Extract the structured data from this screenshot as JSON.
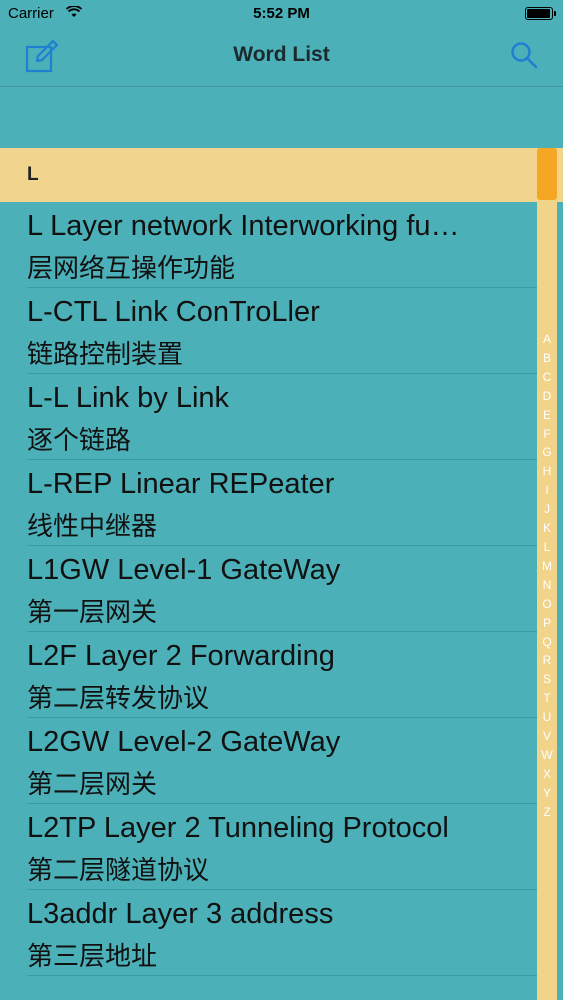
{
  "status": {
    "carrier": "Carrier",
    "time": "5:52 PM"
  },
  "nav": {
    "title": "Word List"
  },
  "section": {
    "letter": "L"
  },
  "words": [
    {
      "en": "L Layer network Interworking fu…",
      "zh": "层网络互操作功能"
    },
    {
      "en": "L-CTL Link ConTroLler",
      "zh": "链路控制装置"
    },
    {
      "en": "L-L Link by Link",
      "zh": "逐个链路"
    },
    {
      "en": "L-REP Linear REPeater",
      "zh": "线性中继器"
    },
    {
      "en": "L1GW Level-1 GateWay",
      "zh": "第一层网关"
    },
    {
      "en": "L2F Layer 2 Forwarding",
      "zh": "第二层转发协议"
    },
    {
      "en": "L2GW Level-2 GateWay",
      "zh": "第二层网关"
    },
    {
      "en": "L2TP Layer 2 Tunneling Protocol",
      "zh": "第二层隧道协议"
    },
    {
      "en": "L3addr Layer 3 address",
      "zh": "第三层地址"
    }
  ],
  "index_letters": [
    "A",
    "B",
    "C",
    "D",
    "E",
    "F",
    "G",
    "H",
    "I",
    "J",
    "K",
    "L",
    "M",
    "N",
    "O",
    "P",
    "Q",
    "R",
    "S",
    "T",
    "U",
    "V",
    "W",
    "X",
    "Y",
    "Z"
  ],
  "colors": {
    "background": "#4bb0b8",
    "section_header": "#f1d58e",
    "accent": "#1f7fd0",
    "scroll_thumb": "#f5a623"
  },
  "icons": {
    "left": "compose-icon",
    "right": "search-icon",
    "wifi": "wifi-icon",
    "battery": "battery-icon"
  }
}
